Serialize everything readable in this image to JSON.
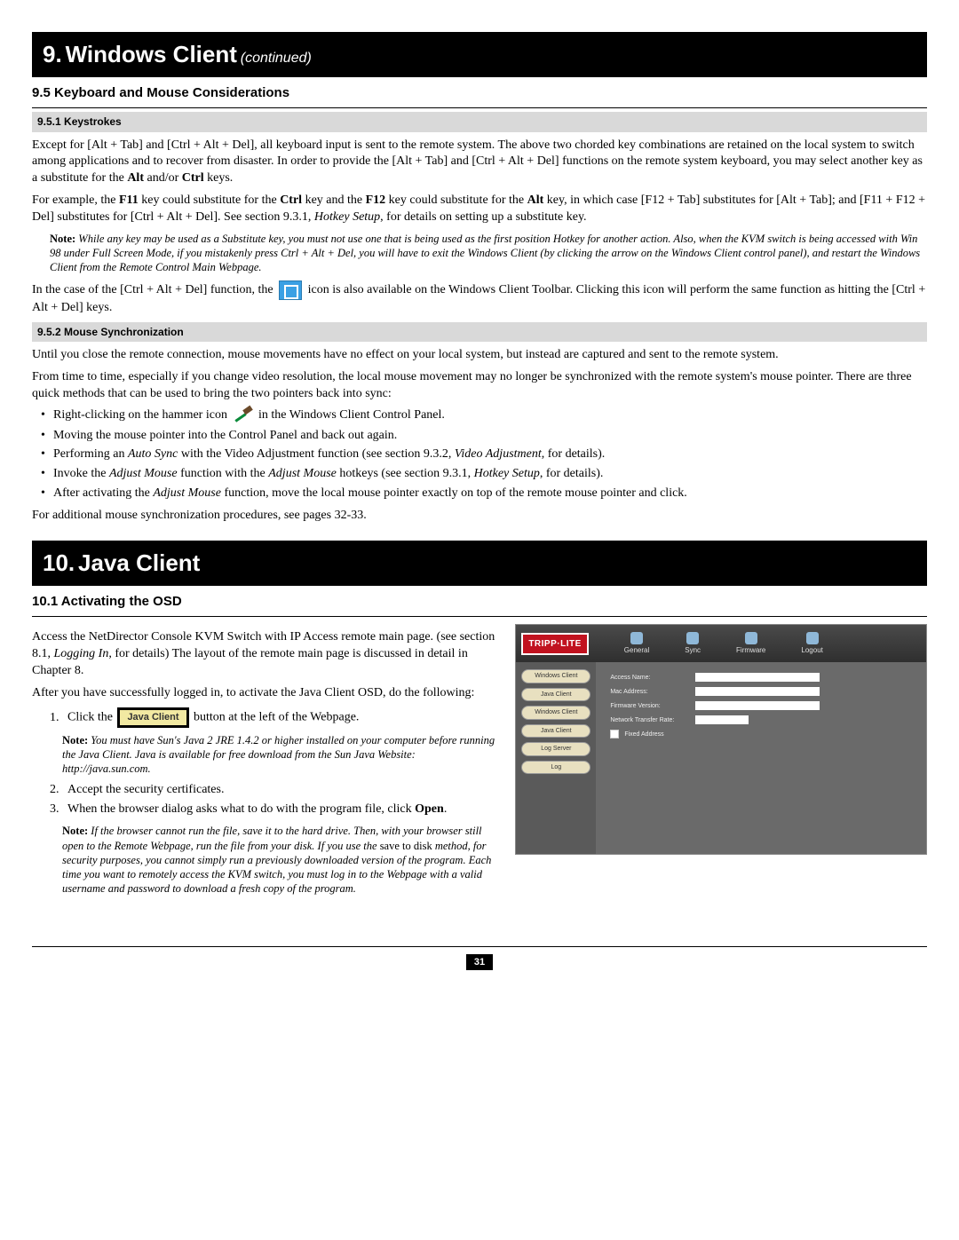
{
  "header1": {
    "number": "9.",
    "title": "Windows Client",
    "suffix": "(continued)"
  },
  "sec95": {
    "title": "9.5 Keyboard and Mouse Considerations",
    "sub1": "9.5.1 Keystrokes",
    "p1a": "Except for [Alt + Tab] and [Ctrl + Alt + Del], all keyboard input is sent to the remote system. The above two chorded key combinations are retained on the local system to switch among applications and to recover from disaster. In order to provide the [Alt + Tab] and [Ctrl + Alt + Del] functions on the remote system keyboard, you may select another key as a substitute for the ",
    "p1b": "Alt",
    "p1c": " and/or ",
    "p1d": "Ctrl",
    "p1e": " keys.",
    "p2a": "For example, the ",
    "p2b": "F11",
    "p2c": " key could substitute for the ",
    "p2d": "Ctrl",
    "p2e": " key and the ",
    "p2f": "F12",
    "p2g": " key could substitute for the ",
    "p2h": "Alt",
    "p2i": " key, in which case [F12 + Tab] substitutes for [Alt + Tab]; and [F11 + F12 + Del] substitutes for [Ctrl + Alt + Del]. See section 9.3.1, ",
    "p2j": "Hotkey Setup",
    "p2k": ", for details on setting up a substitute key.",
    "note1_label": "Note:",
    "note1": " While any key may be used as a Substitute key, you must not use one that is being used as the first position Hotkey for another action. Also, when the KVM switch is being accessed with Win 98 under Full Screen Mode, if you mistakenly press Ctrl + Alt + Del, you will have to exit the Windows Client (by clicking the arrow on the Windows Client control panel), and restart the Windows Client from the Remote Control Main Webpage.",
    "p3a": "In the case of the [Ctrl + Alt + Del] function, the ",
    "p3b": " icon is also available on the Windows Client Toolbar. Clicking this icon will perform the same function as hitting the [Ctrl + Alt + Del] keys.",
    "sub2": "9.5.2 Mouse Synchronization",
    "p4": "Until you close the remote connection, mouse movements have no effect on your local system, but instead are captured and sent to the remote system.",
    "p5": "From time to time, especially if you change video resolution, the local mouse movement may no longer be synchronized with the remote system's mouse pointer. There are three quick methods that can be used to bring the two pointers back into sync:",
    "b1a": "Right-clicking on the hammer icon ",
    "b1b": " in the Windows Client Control Panel.",
    "b2": "Moving the mouse pointer into the Control Panel and back out again.",
    "b3a": "Performing an ",
    "b3b": "Auto Sync",
    "b3c": " with the Video Adjustment function (see section 9.3.2, ",
    "b3d": "Video Adjustment",
    "b3e": ", for details).",
    "b4a": "Invoke the ",
    "b4b": "Adjust Mouse",
    "b4c": " function with the ",
    "b4d": "Adjust Mouse",
    "b4e": " hotkeys (see section 9.3.1, ",
    "b4f": "Hotkey Setup",
    "b4g": ", for details).",
    "b5a": "After activating the ",
    "b5b": "Adjust Mouse",
    "b5c": " function, move the local mouse pointer exactly on top of the remote mouse pointer and click.",
    "p6": "For additional mouse synchronization procedures, see pages 32-33."
  },
  "header2": {
    "number": "10.",
    "title": "Java Client"
  },
  "sec101": {
    "title": "10.1 Activating the OSD",
    "p1a": "Access the NetDirector Console KVM Switch with IP Access remote main page. (see section 8.1, ",
    "p1b": "Logging In",
    "p1c": ", for details) The layout of the remote main page is discussed in detail in Chapter 8.",
    "p2": "After you have successfully logged in, to activate the Java Client OSD, do the following:",
    "s1a": "Click the ",
    "s1btn": "Java Client",
    "s1b": " button at the left of the Webpage.",
    "note2_label": "Note:",
    "note2": " You must have Sun's Java 2 JRE 1.4.2 or higher installed on your computer before running the Java Client. Java is available for free download from the Sun Java Website: http://java.sun.com.",
    "s2": "Accept the security certificates.",
    "s3a": "When the browser dialog asks what to do with the program file, click ",
    "s3b": "Open",
    "s3c": ".",
    "note3_label": "Note:",
    "note3a": " If the browser cannot run the file, save it to the hard drive. Then, with your browser still open to the Remote Webpage, run the file from your disk. If you use the ",
    "note3b": "save to disk",
    "note3c": " method, for security purposes, you cannot simply run a previously downloaded version of the program. Each time you want to remotely access the KVM switch, you must log in to the Webpage with a valid username and password to download a fresh copy of the program."
  },
  "screenshot": {
    "logo": "TRIPP·LITE",
    "tabs": [
      "General",
      "Sync",
      "Firmware",
      "Logout"
    ],
    "side": [
      "Windows Client",
      "Java Client",
      "Windows Client",
      "Java Client",
      "Log Server",
      "Log"
    ],
    "fields": [
      "Access Name:",
      "Mac Address:",
      "Firmware Version:",
      "Network Transfer Rate:"
    ],
    "checkbox": "Fixed Address"
  },
  "page_number": "31"
}
